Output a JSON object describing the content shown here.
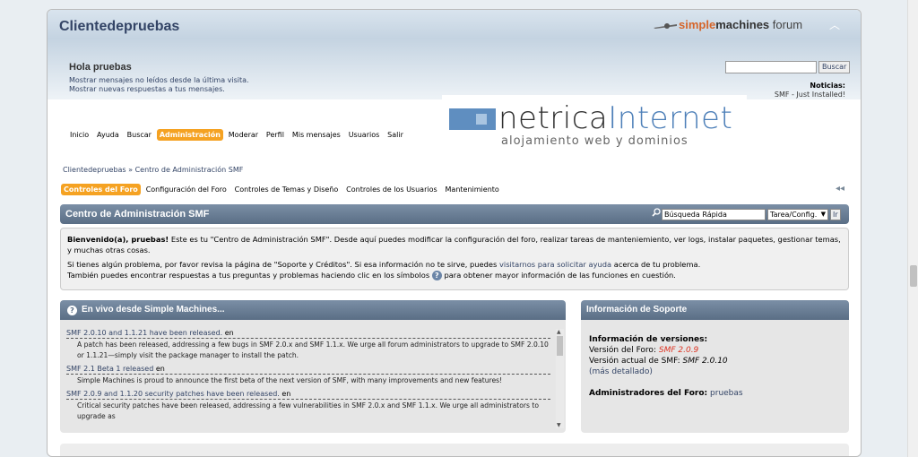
{
  "header": {
    "forum_title": "Clientedepruebas",
    "logo_simple": "simple",
    "logo_machines": "machines",
    "logo_forum": "forum",
    "collapse_glyph": "︿"
  },
  "user": {
    "greeting": "Hola pruebas",
    "links": [
      "Mostrar mensajes no leídos desde la última visita.",
      "Mostrar nuevas respuestas a tus mensajes."
    ]
  },
  "search": {
    "button": "Buscar",
    "value": ""
  },
  "news": {
    "heading": "Noticias:",
    "text": "SMF - Just Installed!"
  },
  "banner": {
    "brand_a": "netrica",
    "brand_b": "Internet",
    "tagline": "alojamiento web y dominios"
  },
  "menu": [
    {
      "label": "Inicio",
      "active": false
    },
    {
      "label": "Ayuda",
      "active": false
    },
    {
      "label": "Buscar",
      "active": false
    },
    {
      "label": "Administración",
      "active": true
    },
    {
      "label": "Moderar",
      "active": false
    },
    {
      "label": "Perfil",
      "active": false
    },
    {
      "label": "Mis mensajes",
      "active": false
    },
    {
      "label": "Usuarios",
      "active": false
    },
    {
      "label": "Salir",
      "active": false
    }
  ],
  "breadcrumb": {
    "home": "Clientedepruebas",
    "sep": "»",
    "current": "Centro de Administración SMF"
  },
  "tabs": [
    {
      "label": "Controles del Foro",
      "active": true
    },
    {
      "label": "Configuración del Foro",
      "active": false
    },
    {
      "label": "Controles de Temas y Diseño",
      "active": false
    },
    {
      "label": "Controles de los Usuarios",
      "active": false
    },
    {
      "label": "Mantenimiento",
      "active": false
    }
  ],
  "rewind_glyph": "◂◂",
  "admin": {
    "title": "Centro de Administración SMF",
    "quick_search": "Búsqueda Rápida",
    "task_select": "Tarea/Config.",
    "go": "Ir"
  },
  "welcome": {
    "bold": "Bienvenido(a), pruebas!",
    "p1": " Este es tu \"Centro de Administración SMF\". Desde aquí puedes modificar la configuración del foro, realizar tareas de manteniemiento, ver logs, instalar paquetes, gestionar temas, y muchas otras cosas.",
    "p2_a": "Si tienes algún problema, por favor revisa la página de \"Soporte y Créditos\". Si esa información no te sirve, puedes ",
    "p2_link": "visitarnos para solicitar ayuda",
    "p2_b": " acerca de tu problema.",
    "p3_a": "También puedes encontrar respuestas a tus preguntas y problemas haciendo clic en los símbolos ",
    "p3_b": " para obtener mayor información de las funciones en cuestión."
  },
  "live": {
    "title": "En vivo desde Simple Machines...",
    "items": [
      {
        "title": "SMF 2.0.10 and 1.1.21 have been released.",
        "lang": "en",
        "desc": "A patch has been released, addressing a few bugs in SMF 2.0.x and SMF 1.1.x. We urge all forum administrators to upgrade to SMF 2.0.10 or 1.1.21—simply visit the package manager to install the patch."
      },
      {
        "title": "SMF 2.1 Beta 1 released",
        "lang": "en",
        "desc": "Simple Machines is proud to announce the first beta of the next version of SMF, with many improvements and new features!"
      },
      {
        "title": "SMF 2.0.9 and 1.1.20 security patches have been released.",
        "lang": "en",
        "desc": "Critical security patches have been released, addressing a few vulnerabilities in SMF 2.0.x and SMF 1.1.x. We urge all administrators to upgrade as"
      }
    ]
  },
  "support": {
    "title": "Información de Soporte",
    "versions_heading": "Información de versiones:",
    "forum_version_label": "Versión del Foro:",
    "forum_version": "SMF 2.0.9",
    "current_version_label": "Versión actual de SMF:",
    "current_version": "SMF 2.0.10",
    "details": "(más detallado)",
    "admins_label": "Administradores del Foro:",
    "admins": "pruebas"
  }
}
